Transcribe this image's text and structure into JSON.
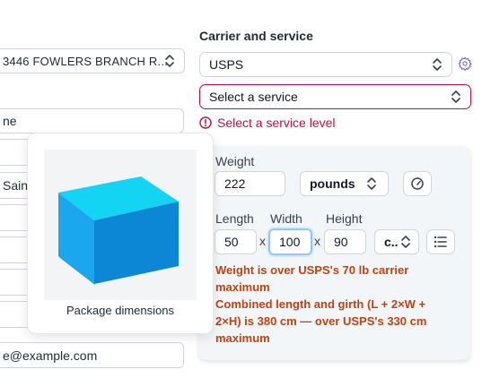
{
  "left": {
    "address_select": "3446 FOWLERS BRANCH R...",
    "name_field": "ne",
    "city_field": "Saint",
    "email_field": "e@example.com"
  },
  "carrier": {
    "heading": "Carrier and service",
    "carrier_value": "USPS",
    "service_placeholder": "Select a service",
    "error_text": "Select a service level"
  },
  "package": {
    "weight_label": "Weight",
    "weight_value": "222",
    "weight_unit": "pounds",
    "length_label": "Length",
    "width_label": "Width",
    "height_label": "Height",
    "length_value": "50",
    "width_value": "100",
    "height_value": "90",
    "separator": "x",
    "dim_unit": "c..",
    "warning_weight": "Weight is over USPS's 70 lb carrier maximum",
    "warning_girth": "Combined length and girth (L + 2×W + 2×H) is 380 cm — over USPS's 330 cm maximum"
  },
  "tooltip": {
    "caption": "Package dimensions"
  },
  "colors": {
    "error": "#be123c",
    "warning": "#c2410c",
    "box_front": "#1aa7ee",
    "box_side": "#0b87d6",
    "box_top": "#14d4f4"
  }
}
